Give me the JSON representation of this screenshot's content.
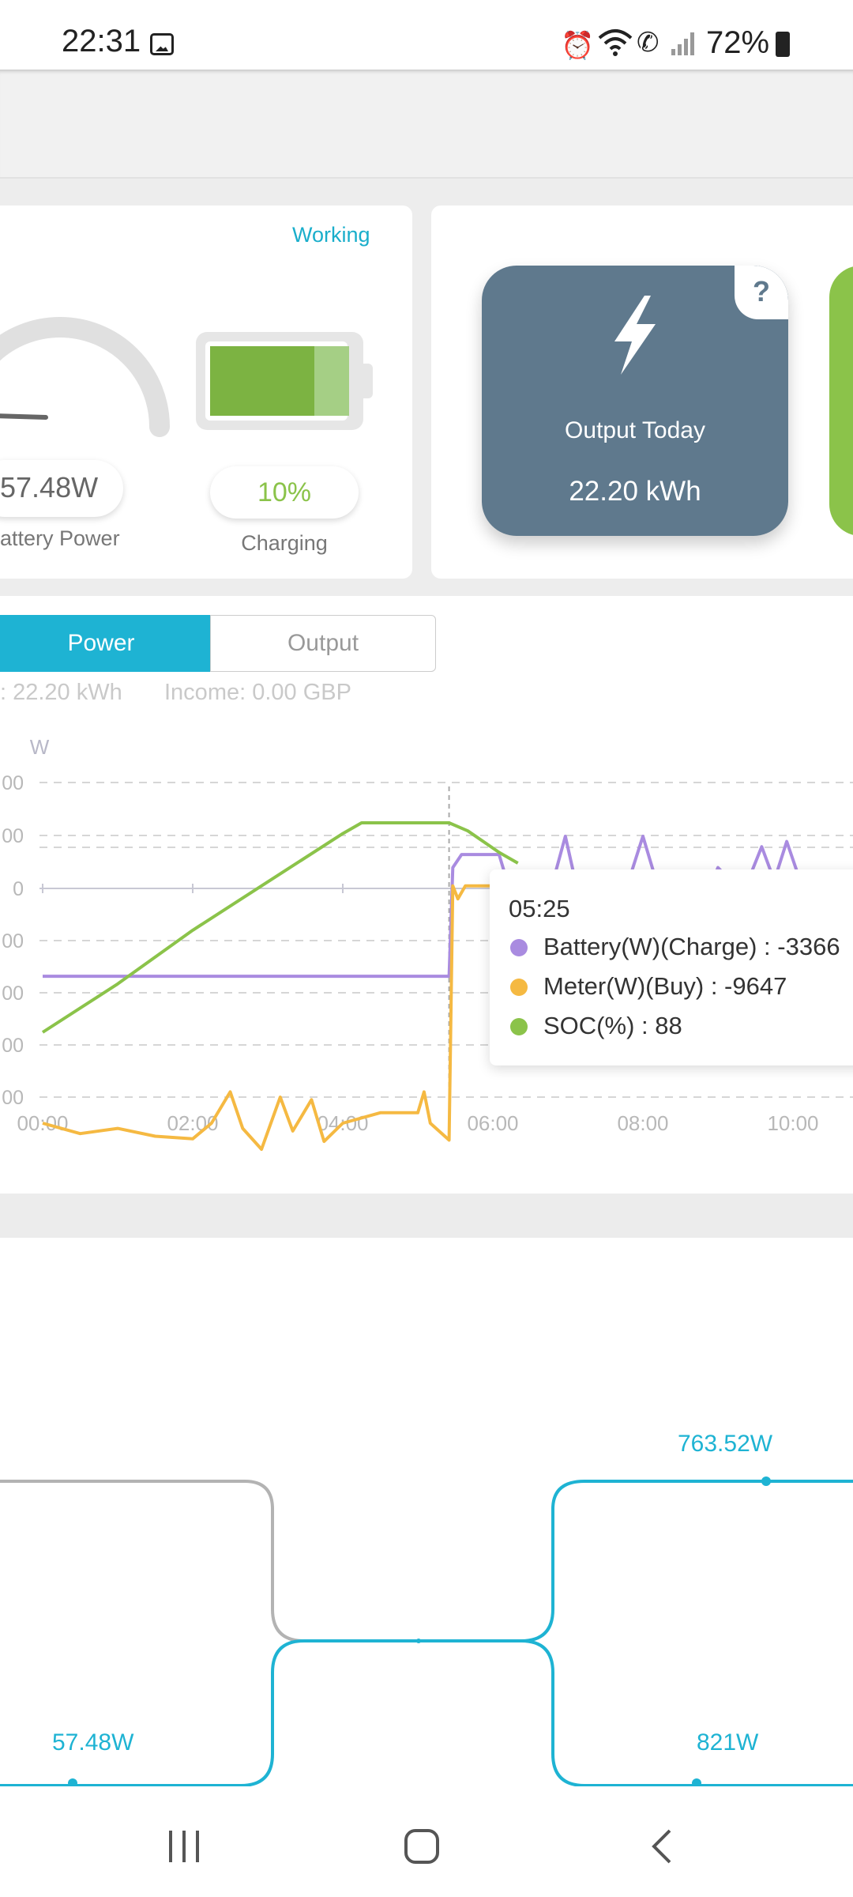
{
  "status_bar": {
    "time": "22:31",
    "battery_percent": "72%",
    "icons": [
      "gallery-icon",
      "alarm-icon",
      "wifi-icon",
      "wifi-call-icon",
      "signal-icon",
      "battery-icon"
    ]
  },
  "battery_card": {
    "status": "Working",
    "battery_power_value": "57.48W",
    "battery_power_label": "attery Power",
    "soc_value": "10%",
    "soc_label": "Charging",
    "soc_level": 0.85
  },
  "output_card": {
    "help_label": "?",
    "output_today_label": "Output Today",
    "output_today_value": "22.20 kWh"
  },
  "chart_section": {
    "tabs": [
      {
        "label": "Power",
        "active": true
      },
      {
        "label": "Output",
        "active": false
      }
    ],
    "energy_summary": ": 22.20 kWh",
    "income_summary": "Income: 0.00 GBP",
    "tooltip": {
      "time": "05:25",
      "rows": [
        {
          "label": "Battery(W)(Charge) : -3366",
          "color": "#a98be0"
        },
        {
          "label": "Meter(W)(Buy) : -9647",
          "color": "#f5b942"
        },
        {
          "label": "SOC(%) : 88",
          "color": "#8bc34a"
        }
      ]
    }
  },
  "chart_data": {
    "type": "line",
    "ylabel": "W",
    "y_tick_labels": [
      "00",
      "00",
      "0",
      "00",
      "00",
      "00",
      "00"
    ],
    "x_ticks": [
      "00:00",
      "02:00",
      "04:00",
      "06:00",
      "08:00",
      "10:00"
    ],
    "xlim": [
      "00:00",
      "11:00"
    ],
    "series": [
      {
        "name": "Battery(W)(Charge)",
        "color": "#a98be0",
        "points": [
          [
            "00:00",
            -3366
          ],
          [
            "05:25",
            -3366
          ],
          [
            "05:28",
            800
          ],
          [
            "05:35",
            1300
          ],
          [
            "06:05",
            1300
          ],
          [
            "06:10",
            500
          ],
          [
            "06:50",
            600
          ],
          [
            "06:58",
            2000
          ],
          [
            "07:05",
            500
          ],
          [
            "07:50",
            500
          ],
          [
            "08:00",
            2000
          ],
          [
            "08:10",
            400
          ],
          [
            "08:55",
            200
          ],
          [
            "09:00",
            800
          ],
          [
            "09:10",
            300
          ],
          [
            "09:25",
            400
          ],
          [
            "09:35",
            1600
          ],
          [
            "09:45",
            300
          ],
          [
            "09:55",
            1800
          ],
          [
            "10:05",
            400
          ],
          [
            "10:40",
            500
          ],
          [
            "11:00",
            300
          ]
        ]
      },
      {
        "name": "Meter(W)(Buy)",
        "color": "#f5b942",
        "points": [
          [
            "00:00",
            -9000
          ],
          [
            "00:30",
            -9400
          ],
          [
            "01:00",
            -9200
          ],
          [
            "01:30",
            -9500
          ],
          [
            "02:00",
            -9600
          ],
          [
            "02:15",
            -9000
          ],
          [
            "02:30",
            -7800
          ],
          [
            "02:40",
            -9200
          ],
          [
            "02:55",
            -10000
          ],
          [
            "03:10",
            -8000
          ],
          [
            "03:20",
            -9300
          ],
          [
            "03:35",
            -8100
          ],
          [
            "03:45",
            -9700
          ],
          [
            "04:00",
            -9000
          ],
          [
            "04:30",
            -8600
          ],
          [
            "05:00",
            -8600
          ],
          [
            "05:05",
            -7800
          ],
          [
            "05:10",
            -9000
          ],
          [
            "05:25",
            -9647
          ],
          [
            "05:28",
            100
          ],
          [
            "05:32",
            -400
          ],
          [
            "05:38",
            100
          ],
          [
            "06:00",
            100
          ]
        ]
      },
      {
        "name": "SOC(%)",
        "color": "#8bc34a",
        "points": [
          [
            "00:00",
            10
          ],
          [
            "01:00",
            28
          ],
          [
            "02:00",
            48
          ],
          [
            "03:00",
            66
          ],
          [
            "04:00",
            84
          ],
          [
            "04:15",
            88
          ],
          [
            "05:25",
            88
          ],
          [
            "05:40",
            85
          ],
          [
            "06:05",
            77
          ],
          [
            "06:20",
            73
          ]
        ]
      }
    ]
  },
  "flow": {
    "top_right_value": "763.52W",
    "bottom_left_value": "57.48W",
    "bottom_right_value": "821W"
  },
  "nav_bar": {
    "buttons": [
      "recent-apps-icon",
      "home-icon",
      "back-icon"
    ]
  }
}
